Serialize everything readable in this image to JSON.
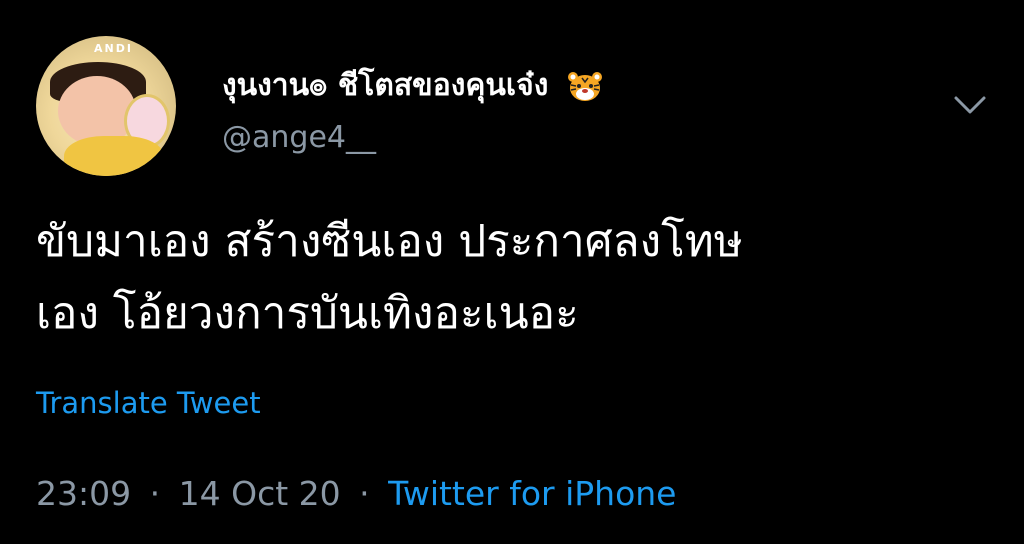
{
  "author": {
    "display_name": "งุนงาน๏ ชีโตสของคุนเจ๋ง",
    "name_emoji": "tiger-face-icon",
    "handle": "@ange4__",
    "avatar_tag": "ANDI"
  },
  "tweet": {
    "text_line1": "ขับมาเอง สร้างซีนเอง ประกาศลงโทษ",
    "text_line2": "เอง โอ้ยวงการบันเทิงอะเนอะ"
  },
  "actions": {
    "translate_label": "Translate Tweet",
    "menu_icon": "chevron-down-icon"
  },
  "meta": {
    "time": "23:09",
    "separator": "·",
    "date": "14 Oct 20",
    "source": "Twitter for iPhone"
  },
  "colors": {
    "background": "#000000",
    "primary_text": "#ffffff",
    "secondary_text": "#8b98a5",
    "link": "#1d9bf0"
  }
}
